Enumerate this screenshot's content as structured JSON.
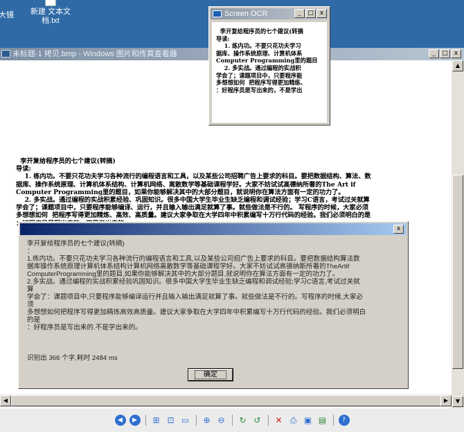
{
  "desktop": {
    "icons": [
      {
        "label": "大镜",
        "icon": "magnifier-icon"
      },
      {
        "label": "新建 文本文\n档.txt",
        "icon": "text-file-icon"
      }
    ]
  },
  "viewer": {
    "title": "未标题-1 拷贝.bmp - Windows 图片和传真查看器",
    "window_buttons": [
      "_",
      "□",
      "x"
    ],
    "image_text": "  李开复给程序员的七个建议(转摘)\n导读:\n    1. 练内功。不要只花功夫学习各种流行的编程语言和工具，以及某些公司招聘广告上要求的科目。要把数据结构、算法、数\n据库、操作系统原理、计算机体系结构、计算机网络、离散数学等基础课程学好。大家不妨试试高德纳所著的The Art if\nComputer Programming里的题目，如果你能够解决其中的大部分题目，就说明你在算法方面有一定的功力了。\n    2. 多实战。通过编程的实战积累经验、巩固知识。很多中国大学生毕业生缺乏编程和调试经验；学习C语言，考试过关就算\n学会了；课题项目中，只要程序能够编译、运行，并且输入输出满足就算了事。就些做法是不行的。 写程序的时候，大家必须\n多想想如何  把程序写得更加精炼、高效、高质量。建议大家争取在大学四年中积累编写十万行代码的经验。我们必须明白的是\n：好程序员是写出来的，不是学出来的。",
    "toolbar_icons": [
      "previous-image-icon",
      "next-image-icon",
      "best-fit-icon",
      "actual-size-icon",
      "slideshow-icon",
      "zoom-in-icon",
      "zoom-out-icon",
      "rotate-clockwise-icon",
      "rotate-counterclockwise-icon",
      "delete-icon",
      "print-icon",
      "save-icon",
      "open-icon",
      "help-icon"
    ]
  },
  "ocr_window": {
    "title": "Screen OCR",
    "preview_text": "  李开复给程序员的七个建议(转摘\n导读:\n    1. 练内功。不要只花功夫学习\n据库、操作系统原理、计算机体系\nComputer Programming里的题目\n    2. 多实战。通过编程的实战积\n学会了；课题项目中，只要程序能\n多想想如何  把程序写得更加精练、\n：好程序员是写出来的，不是学出"
  },
  "dialog": {
    "close_label": "x",
    "body_text": "李开复给程序员的七个建议(转摘)\n：\n1.练内功。不要只花功夫学习各种流行的编程语言和工具,以及某些公司招广告上要求的科目。要把数据结构算法数\n据库操作系统原理计算机体系结构计算机网络离散数学等基础课程学好。大家不妨试试高德纳斯所著的TheArtif\nComputerProgramming里的题目,如果你能够解决其中的大部分题目,就说明你在算法方面有一定的功力了。\n2.多实战。通过编程的实战积累经验巩固知识。很多中国大学生毕业生缺乏编程和调试经验;学习C语言,考试过关就\n算\n学会了：课题项目中,只要程序能够编译运行并且输入输出满足就算了事。就些做法是不行的。写程序的时候,大家必\n须\n多想想如何把程序写得更加精炼高效高质量。建议大家争取在大学四年中积累编写十万行代码的经验。我们必须明白\n的是\n：好程序员是写出来的.不是学出来的。",
    "summary": "识别出 366 个字,耗时 2484 ms",
    "ok_label": "确定"
  }
}
